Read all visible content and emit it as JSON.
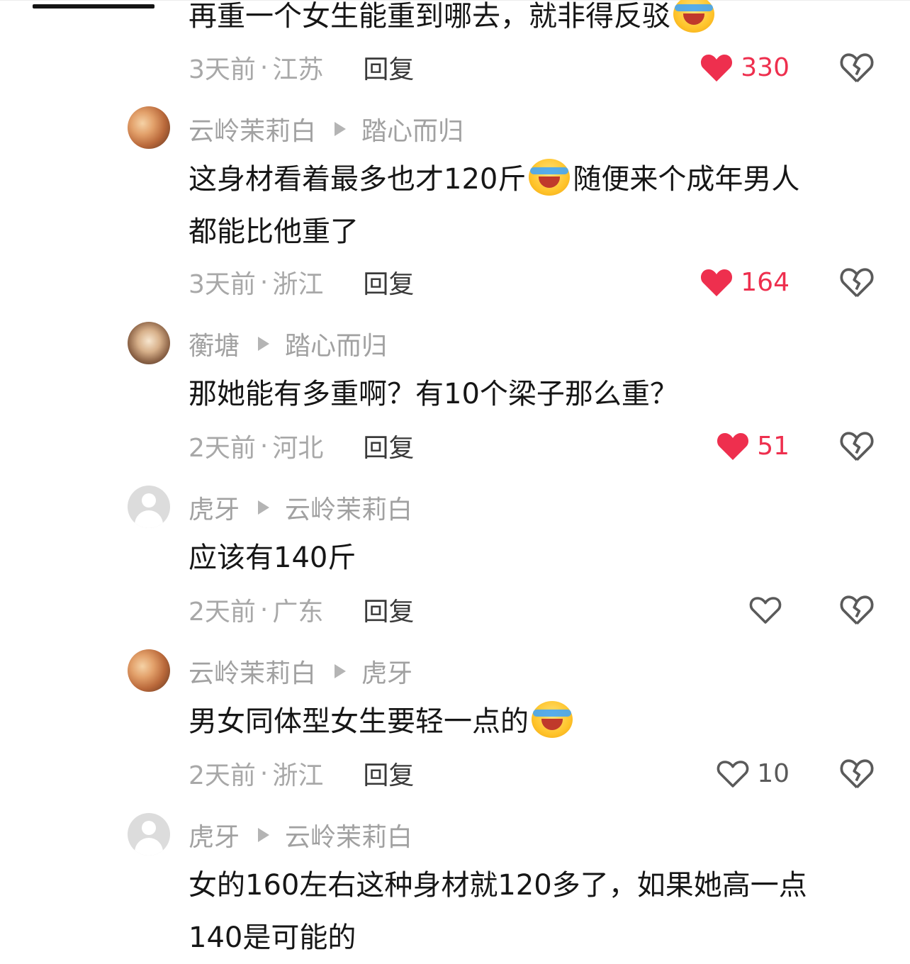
{
  "comments": [
    {
      "text_before": "再重一个女生能重到哪去，就非得反驳",
      "text_after": "",
      "time": "3天前",
      "location": "江苏",
      "reply_label": "回复",
      "likes": "330",
      "liked": true
    },
    {
      "author": "云岭茉莉白",
      "reply_to": "踏心而归",
      "avatar": "photo-avatar",
      "line1_before": "这身材看着最多也才120斤",
      "line1_after": "随便来个成年男人",
      "line2": "都能比他重了",
      "time": "3天前",
      "location": "浙江",
      "reply_label": "回复",
      "likes": "164",
      "liked": true
    },
    {
      "author": "蘅塘",
      "reply_to": "踏心而归",
      "avatar": "photo-avatar",
      "line1": "那她能有多重啊？有10个梁子那么重？",
      "time": "2天前",
      "location": "河北",
      "reply_label": "回复",
      "likes": "51",
      "liked": true
    },
    {
      "author": "虎牙",
      "reply_to": "云岭茉莉白",
      "avatar": "default-avatar",
      "line1": "应该有140斤",
      "time": "2天前",
      "location": "广东",
      "reply_label": "回复",
      "likes": "",
      "liked": false
    },
    {
      "author": "云岭茉莉白",
      "reply_to": "虎牙",
      "avatar": "photo-avatar",
      "line1_before": "男女同体型女生要轻一点的",
      "time": "2天前",
      "location": "浙江",
      "reply_label": "回复",
      "likes": "10",
      "liked": false
    },
    {
      "author": "虎牙",
      "reply_to": "云岭茉莉白",
      "avatar": "default-avatar",
      "line1": "女的160左右这种身材就120多了，如果她高一点",
      "line2": "140是可能的"
    }
  ],
  "separator": "·",
  "colors": {
    "like_red": "#ee2f4e",
    "meta_gray": "#a8a8a8",
    "text": "#161616"
  },
  "icons": {
    "emoji": "laughing-crying-emoji-icon",
    "like": "heart-icon",
    "dislike": "broken-heart-icon",
    "arrow": "arrow-right-icon"
  }
}
